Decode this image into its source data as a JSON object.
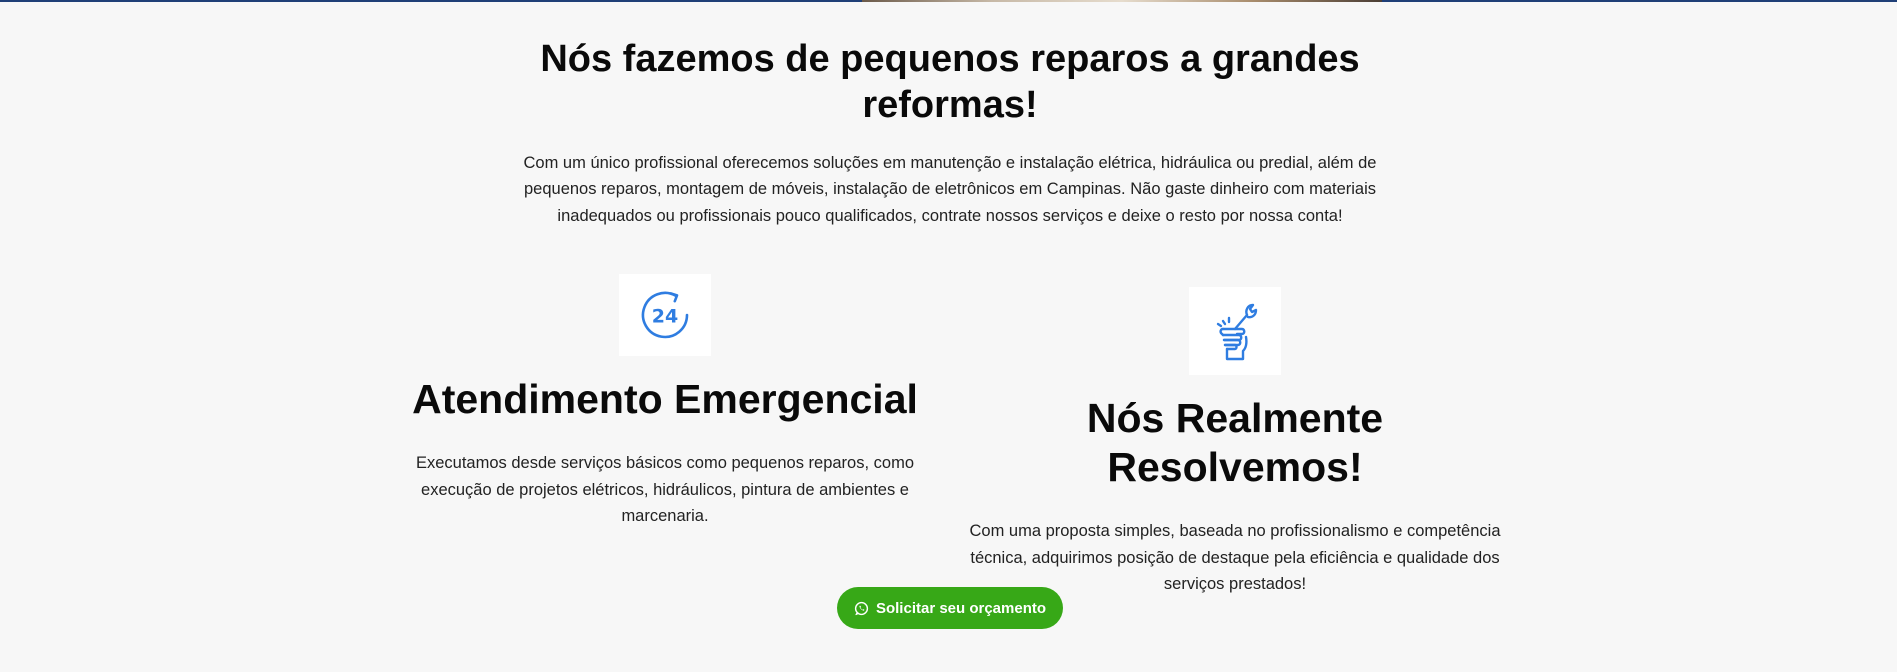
{
  "hero": {
    "heading": "Nós fazemos de pequenos reparos a grandes reformas!",
    "intro": "Com um único profissional oferecemos soluções em manutenção e instalação elétrica, hidráulica ou predial, além de pequenos reparos, montagem de móveis, instalação de eletrônicos em Campinas. Não gaste dinheiro com materiais inadequados ou profissionais pouco qualificados, contrate nossos serviços e deixe o resto por nossa conta!"
  },
  "features": [
    {
      "icon": "clock-24-icon",
      "title": "Atendimento Emergencial",
      "text": "Executamos desde serviços básicos como pequenos reparos, como execução de projetos elétricos, hidráulicos, pintura de ambientes e marcenaria."
    },
    {
      "icon": "hand-wrench-icon",
      "title": "Nós Realmente Resolvemos!",
      "text": "Com uma proposta simples, baseada no profissionalismo e competência técnica, adquirimos posição de destaque pela eficiência e qualidade dos serviços prestados!"
    }
  ],
  "cta": {
    "icon": "whatsapp-icon",
    "label": "Solicitar seu orçamento"
  },
  "colors": {
    "background": "#f7f7f7",
    "icon_blue": "#2f7de1",
    "button_green": "#37a817",
    "top_bar": "#1f3f77"
  },
  "badge_text": "24"
}
